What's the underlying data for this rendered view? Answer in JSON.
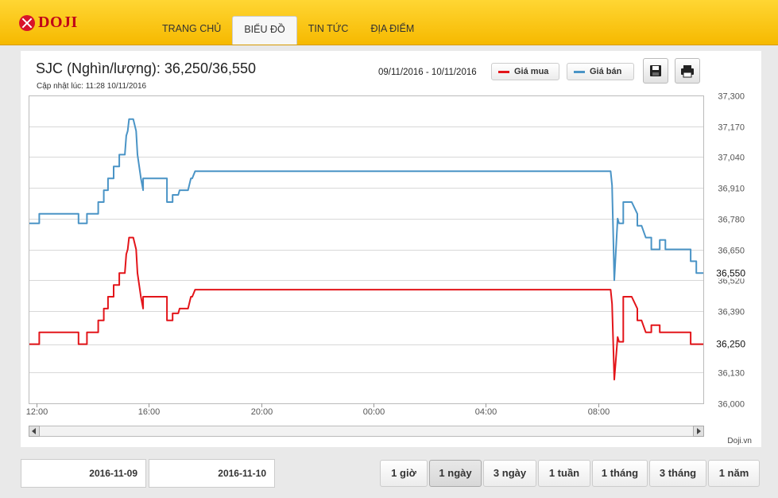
{
  "header": {
    "logo_text": "DOJI",
    "nav": [
      {
        "label": "TRANG CHỦ",
        "active": false
      },
      {
        "label": "BIỂU ĐỒ",
        "active": true
      },
      {
        "label": "TIN TỨC",
        "active": false
      },
      {
        "label": "ĐỊA ĐIỂM",
        "active": false
      }
    ]
  },
  "chart_header": {
    "title": "SJC (Nghìn/lượng): 36,250/36,550",
    "updated": "Cập nhật lúc: 11:28 10/11/2016",
    "date_range": "09/11/2016 - 10/11/2016",
    "legend_buy": "Giá mua",
    "legend_sell": "Giá bán",
    "credit": "Doji.vn"
  },
  "colors": {
    "buy": "#e3151a",
    "sell": "#4a94c6"
  },
  "icons": [
    "save-icon",
    "print-icon",
    "scroll-left-icon",
    "scroll-right-icon"
  ],
  "footer": {
    "date_from": "2016-11-09",
    "date_to": "2016-11-10",
    "ranges": [
      {
        "label": "1 giờ",
        "active": false
      },
      {
        "label": "1 ngày",
        "active": true
      },
      {
        "label": "3 ngày",
        "active": false
      },
      {
        "label": "1 tuần",
        "active": false
      },
      {
        "label": "1 tháng",
        "active": false
      },
      {
        "label": "3 tháng",
        "active": false
      },
      {
        "label": "1 năm",
        "active": false
      }
    ]
  },
  "chart_data": {
    "type": "line",
    "title": "SJC (Nghìn/lượng): 36,250/36,550",
    "ylim": [
      36000,
      37300
    ],
    "xlim": [
      11.75,
      35.75
    ],
    "yticks": [
      36000,
      36130,
      36250,
      36390,
      36520,
      36650,
      36780,
      36910,
      37040,
      37170,
      37300
    ],
    "ytick_labels": [
      "36,000",
      "36,130",
      "36,250",
      "36,390",
      "36,520",
      "36,650",
      "36,780",
      "36,910",
      "37,040",
      "37,170",
      "37,300"
    ],
    "xticks": [
      12,
      16,
      20,
      24,
      28,
      32
    ],
    "xtick_labels": [
      "12:00",
      "16:00",
      "20:00",
      "00:00",
      "04:00",
      "08:00"
    ],
    "last_labels": [
      "36,550",
      "36,250"
    ],
    "grid": true,
    "series": [
      {
        "name": "Giá bán",
        "color": "#4a94c6",
        "x": [
          11.75,
          12.1,
          12.1,
          13.5,
          13.5,
          13.8,
          13.8,
          14.2,
          14.2,
          14.4,
          14.4,
          14.55,
          14.55,
          14.75,
          14.75,
          14.95,
          14.95,
          15.15,
          15.2,
          15.25,
          15.3,
          15.35,
          15.45,
          15.55,
          15.6,
          15.72,
          15.8,
          15.8,
          16.65,
          16.65,
          16.85,
          16.85,
          17.05,
          17.1,
          17.4,
          17.5,
          17.55,
          17.65,
          32.45,
          32.5,
          32.58,
          32.7,
          32.75,
          32.9,
          32.9,
          33.2,
          33.4,
          33.4,
          33.55,
          33.7,
          33.9,
          33.9,
          34.2,
          34.2,
          34.4,
          34.4,
          35.3,
          35.3,
          35.5,
          35.5,
          35.75
        ],
        "y": [
          36760,
          36760,
          36800,
          36800,
          36760,
          36760,
          36800,
          36800,
          36850,
          36850,
          36900,
          36900,
          36950,
          36950,
          37000,
          37000,
          37050,
          37050,
          37130,
          37150,
          37200,
          37200,
          37200,
          37150,
          37050,
          36950,
          36900,
          36950,
          36950,
          36850,
          36850,
          36880,
          36880,
          36900,
          36900,
          36950,
          36950,
          36980,
          36980,
          36920,
          36520,
          36780,
          36760,
          36760,
          36850,
          36850,
          36800,
          36750,
          36750,
          36700,
          36700,
          36650,
          36650,
          36690,
          36690,
          36650,
          36650,
          36600,
          36600,
          36550,
          36550
        ]
      },
      {
        "name": "Giá mua",
        "color": "#e3151a",
        "x": [
          11.75,
          12.1,
          12.1,
          13.5,
          13.5,
          13.8,
          13.8,
          14.2,
          14.2,
          14.4,
          14.4,
          14.55,
          14.55,
          14.75,
          14.75,
          14.95,
          14.95,
          15.15,
          15.2,
          15.25,
          15.3,
          15.35,
          15.45,
          15.55,
          15.6,
          15.72,
          15.8,
          15.8,
          16.65,
          16.65,
          16.85,
          16.85,
          17.05,
          17.1,
          17.4,
          17.5,
          17.55,
          17.65,
          32.45,
          32.5,
          32.58,
          32.7,
          32.75,
          32.9,
          32.9,
          33.2,
          33.4,
          33.4,
          33.55,
          33.7,
          33.9,
          33.9,
          34.2,
          34.2,
          34.4,
          34.4,
          35.3,
          35.3,
          35.5,
          35.5,
          35.75
        ],
        "y": [
          36250,
          36250,
          36300,
          36300,
          36250,
          36250,
          36300,
          36300,
          36350,
          36350,
          36400,
          36400,
          36450,
          36450,
          36500,
          36500,
          36550,
          36550,
          36630,
          36650,
          36700,
          36700,
          36700,
          36650,
          36550,
          36450,
          36400,
          36450,
          36450,
          36350,
          36350,
          36380,
          36380,
          36400,
          36400,
          36450,
          36450,
          36480,
          36480,
          36420,
          36100,
          36280,
          36260,
          36260,
          36450,
          36450,
          36400,
          36350,
          36350,
          36300,
          36300,
          36330,
          36330,
          36300,
          36300,
          36300,
          36300,
          36250,
          36250,
          36250,
          36250
        ]
      }
    ]
  }
}
